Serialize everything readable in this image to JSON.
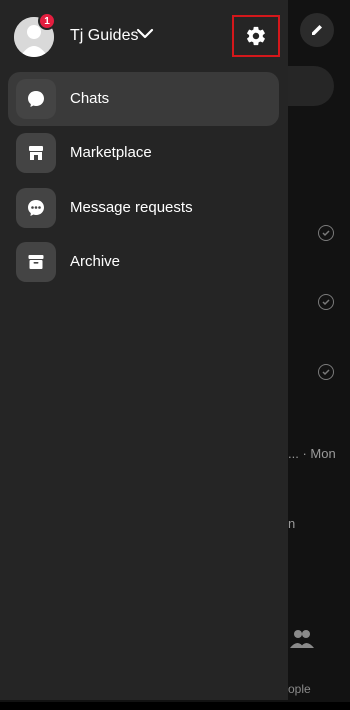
{
  "profile": {
    "name": "Tj Guides",
    "notification_count": "1"
  },
  "menu": {
    "items": [
      {
        "label": "Chats",
        "icon": "chat-bubble-icon",
        "active": true
      },
      {
        "label": "Marketplace",
        "icon": "storefront-icon",
        "active": false
      },
      {
        "label": "Message requests",
        "icon": "message-requests-icon",
        "active": false
      },
      {
        "label": "Archive",
        "icon": "archive-box-icon",
        "active": false
      }
    ]
  },
  "background": {
    "time_text": "... · Mon",
    "truncated_text": "n",
    "people_label": "ople"
  },
  "colors": {
    "drawer_bg": "#252525",
    "active_item_bg": "#3a3a3a",
    "badge_red": "#e41e3f",
    "highlight_border": "#d4171b"
  }
}
